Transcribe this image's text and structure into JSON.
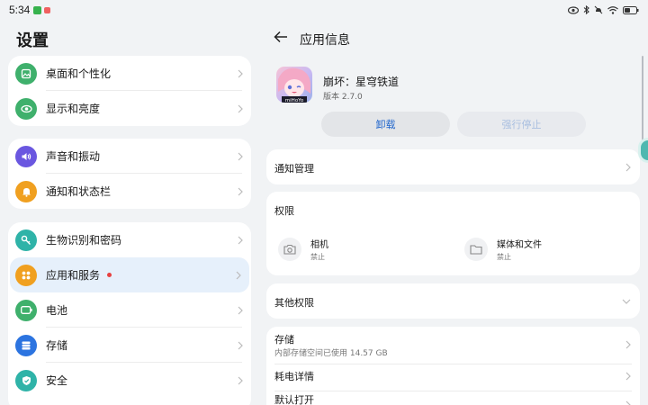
{
  "status": {
    "time": "5:34",
    "icons": [
      "wechat-icon",
      "notification-icon",
      "eye-icon",
      "bluetooth-icon",
      "mute-icon",
      "wifi-icon",
      "battery-icon"
    ]
  },
  "left": {
    "title": "设置",
    "groups": [
      [
        {
          "label": "桌面和个性化",
          "icon": "wallpaper-icon",
          "color": "#3fb06c"
        },
        {
          "label": "显示和亮度",
          "icon": "eye-display-icon",
          "color": "#3fb06c"
        }
      ],
      [
        {
          "label": "声音和振动",
          "icon": "speaker-icon",
          "color": "#6a57e0"
        },
        {
          "label": "通知和状态栏",
          "icon": "bell-icon",
          "color": "#f0a020"
        }
      ],
      [
        {
          "label": "生物识别和密码",
          "icon": "key-icon",
          "color": "#2fb3a8"
        },
        {
          "label": "应用和服务",
          "icon": "apps-icon",
          "color": "#f0a020"
        },
        {
          "label": "电池",
          "icon": "battery-icon",
          "color": "#3fb06c"
        },
        {
          "label": "存储",
          "icon": "storage-icon",
          "color": "#2c74e0"
        },
        {
          "label": "安全",
          "icon": "shield-icon",
          "color": "#2fb3a8"
        }
      ]
    ]
  },
  "right": {
    "title": "应用信息",
    "app_name": "崩坏：星穹铁道",
    "app_version": "版本 2.7.0",
    "app_icon_text": "miHoYo",
    "uninstall_label": "卸载",
    "force_stop_label": "强行停止",
    "notification_mgmt": "通知管理",
    "permissions_title": "权限",
    "permissions": [
      {
        "name": "相机",
        "state": "禁止",
        "icon": "camera-icon"
      },
      {
        "name": "媒体和文件",
        "state": "禁止",
        "icon": "folder-icon"
      }
    ],
    "other_permissions": "其他权限",
    "storage_label": "存储",
    "storage_sub": "内部存储空间已使用 14.57 GB",
    "power_label": "耗电详情",
    "default_open_label": "默认打开"
  }
}
